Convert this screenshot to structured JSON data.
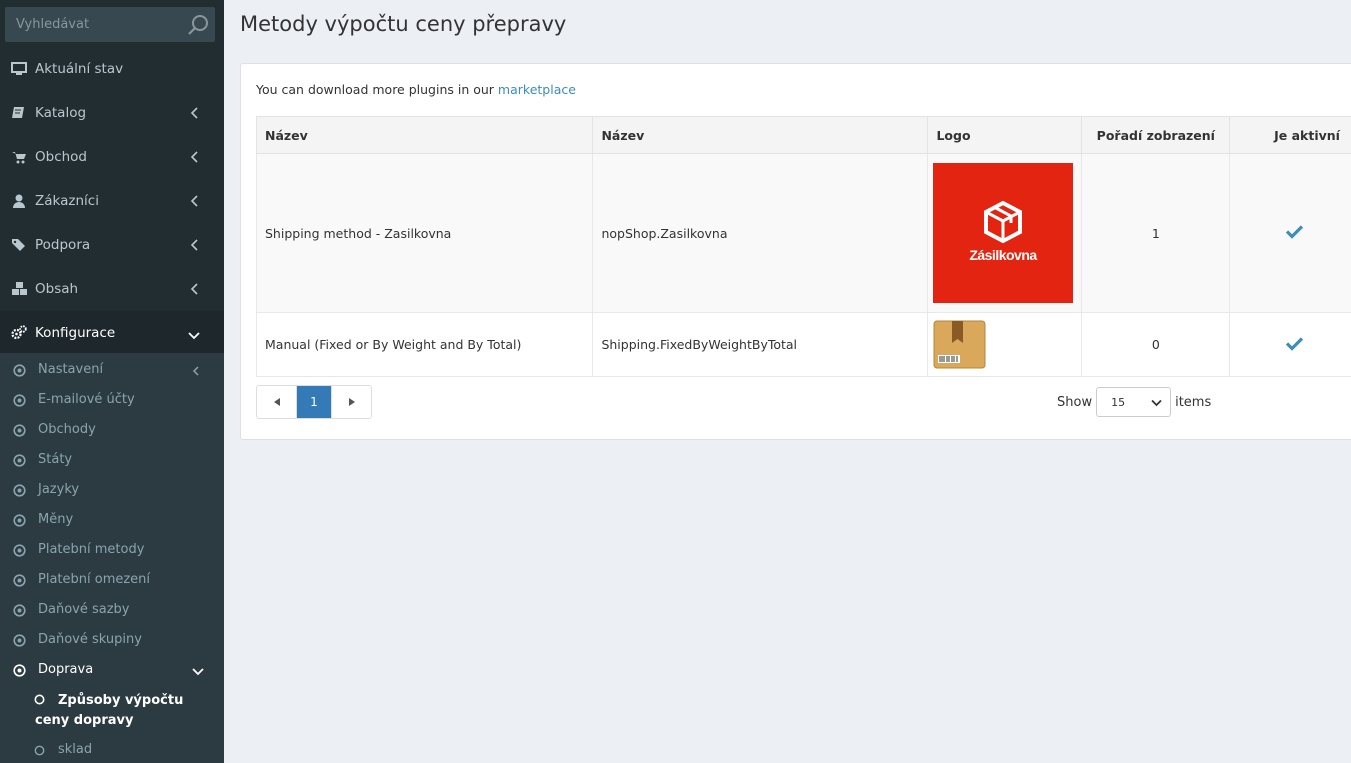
{
  "search": {
    "placeholder": "Vyhledávat"
  },
  "sidebar": {
    "items": [
      {
        "label": "Aktuální stav"
      },
      {
        "label": "Katalog"
      },
      {
        "label": "Obchod"
      },
      {
        "label": "Zákazníci"
      },
      {
        "label": "Podpora"
      },
      {
        "label": "Obsah"
      },
      {
        "label": "Konfigurace"
      }
    ],
    "config_items": [
      {
        "label": "Nastavení"
      },
      {
        "label": "E-mailové účty"
      },
      {
        "label": "Obchody"
      },
      {
        "label": "Státy"
      },
      {
        "label": "Jazyky"
      },
      {
        "label": "Měny"
      },
      {
        "label": "Platební metody"
      },
      {
        "label": "Platební omezení"
      },
      {
        "label": "Daňové sazby"
      },
      {
        "label": "Daňové skupiny"
      },
      {
        "label": "Doprava"
      }
    ],
    "shipping_items": [
      {
        "label": "Způsoby výpočtu ceny dopravy"
      },
      {
        "label": "sklad"
      }
    ]
  },
  "page": {
    "title": "Metody výpočtu ceny přepravy",
    "info_prefix": "You can download more plugins in our ",
    "info_link": "marketplace"
  },
  "table": {
    "headers": [
      "Název",
      "Název",
      "Logo",
      "Pořadí zobrazení",
      "Je aktivní"
    ],
    "rows": [
      {
        "friendly_name": "Shipping method - Zasilkovna",
        "system_name": "nopShop.Zasilkovna",
        "logo_text": "Zásilkovna",
        "order": "1",
        "active": true
      },
      {
        "friendly_name": "Manual (Fixed or By Weight and By Total)",
        "system_name": "Shipping.FixedByWeightByTotal",
        "order": "0",
        "active": true
      }
    ]
  },
  "pager": {
    "current": "1",
    "show_label": "Show",
    "page_size": "15",
    "items_label": "items"
  },
  "colors": {
    "sidebar_bg": "#222d32",
    "submenu_bg": "#2c3b41",
    "accent": "#3c8dbc",
    "pager_active": "#337ab7",
    "logo_red": "#e22410"
  }
}
